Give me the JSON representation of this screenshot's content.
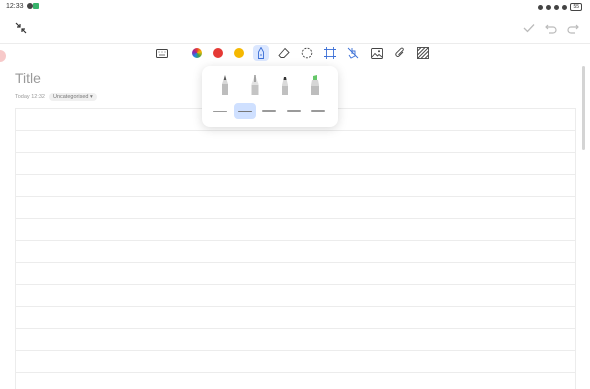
{
  "status_bar": {
    "time": "12:33",
    "battery": "55"
  },
  "toolbar": {
    "tools": [
      "keyboard-icon",
      "color-wheel-icon",
      "red-color",
      "yellow-color",
      "pen-icon",
      "eraser-icon",
      "lasso-icon",
      "crop-icon",
      "touch-icon",
      "image-icon",
      "attachment-icon",
      "texture-icon"
    ],
    "colors": {
      "red": "#e53935",
      "yellow": "#f5b800",
      "accent": "#3b6fd6"
    }
  },
  "note": {
    "title": "Title",
    "date": "Today 12:32",
    "category": "Uncategorised"
  },
  "pen_popup": {
    "pens": [
      "pencil",
      "fountain-pen",
      "marker",
      "highlighter"
    ],
    "stroke_widths": [
      1,
      2,
      3,
      4,
      5
    ],
    "selected_stroke_index": 1
  }
}
